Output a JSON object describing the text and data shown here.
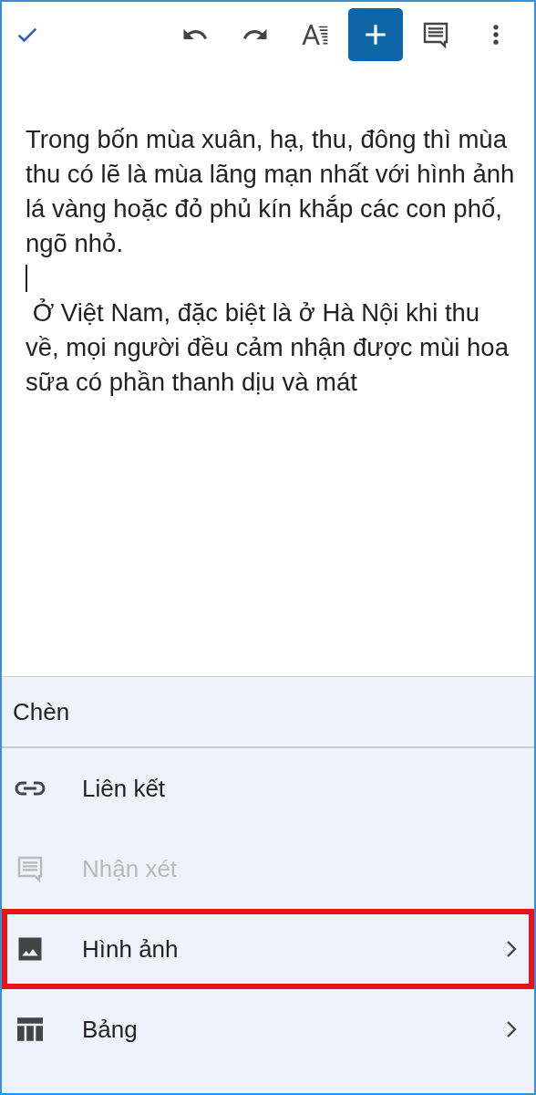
{
  "toolbar": [
    {
      "kind": "done",
      "selected": false
    },
    {
      "kind": "undo",
      "selected": false
    },
    {
      "kind": "redo",
      "selected": false
    },
    {
      "kind": "format",
      "selected": false
    },
    {
      "kind": "insert",
      "selected": true
    },
    {
      "kind": "comment",
      "selected": false
    },
    {
      "kind": "more",
      "selected": false
    }
  ],
  "document": {
    "paragraphs": [
      {
        "text": "Trong bốn mùa xuân, hạ, thu, đông thì mùa thu có lẽ là mùa lãng mạn nhất với hình ảnh lá vàng hoặc đỏ phủ kín khắp các con phố, ngõ nhỏ.",
        "cursor_after": true
      },
      {
        "text": " Ở Việt Nam, đặc biệt là ở Hà Nội khi thu về, mọi người đều cảm nhận được mùi hoa sữa có phần thanh dịu và mát",
        "cursor_after": false
      }
    ]
  },
  "insert_menu": {
    "title": "Chèn",
    "items": [
      {
        "kind": "link",
        "label": "Liên kết",
        "disabled": false,
        "highlighted": false,
        "submenu": false
      },
      {
        "kind": "comment",
        "label": "Nhận xét",
        "disabled": true,
        "highlighted": false,
        "submenu": false
      },
      {
        "kind": "image",
        "label": "Hình ảnh",
        "disabled": false,
        "highlighted": true,
        "submenu": true
      },
      {
        "kind": "table",
        "label": "Bảng",
        "disabled": false,
        "highlighted": false,
        "submenu": true
      }
    ]
  }
}
